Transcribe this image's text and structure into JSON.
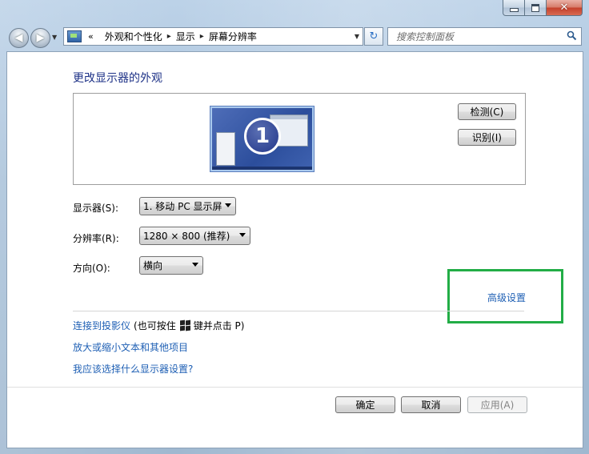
{
  "window": {
    "close_label": "✕"
  },
  "nav": {
    "back_glyph": "◀",
    "forward_glyph": "▶",
    "dropdown_glyph": "▼"
  },
  "address": {
    "icon": "control-panel-icon",
    "overflow": "«",
    "breadcrumbs": [
      "外观和个性化",
      "显示",
      "屏幕分辨率"
    ],
    "separator": "▸",
    "dropdown_glyph": "▼"
  },
  "refresh_glyph": "↻",
  "search": {
    "placeholder": "搜索控制面板",
    "icon": "search-icon"
  },
  "main": {
    "title": "更改显示器的外观",
    "monitor_number": "1",
    "detect_button": "检测(C)",
    "identify_button": "识别(I)",
    "display_label": "显示器(S):",
    "display_value": "1. 移动 PC 显示屏",
    "resolution_label": "分辨率(R):",
    "resolution_value": "1280 × 800 (推荐)",
    "orientation_label": "方向(O):",
    "orientation_value": "横向",
    "advanced_link": "高级设置",
    "projector_link": "连接到投影仪",
    "projector_hint_prefix": "(也可按住",
    "projector_hint_suffix": "键并点击 P)",
    "text_size_link": "放大或缩小文本和其他项目",
    "which_settings_link": "我应该选择什么显示器设置?"
  },
  "footer": {
    "ok_button": "确定",
    "cancel_button": "取消",
    "apply_button": "应用(A)"
  },
  "colors": {
    "link": "#1e5fb4",
    "title": "#1e3287",
    "highlight": "#22ad46"
  }
}
